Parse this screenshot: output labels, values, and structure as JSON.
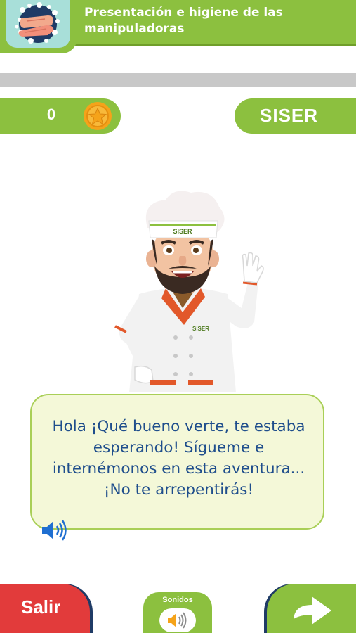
{
  "header": {
    "title": "Presentación e higiene de las manipuladoras",
    "icon": "handwashing-icon"
  },
  "progress": {
    "value": 0
  },
  "score": {
    "value": "0",
    "icon": "star-coin-icon"
  },
  "brand": {
    "name": "SISER"
  },
  "character": {
    "icon": "chef-character"
  },
  "dialog": {
    "text": "Hola ¡Qué bueno verte, te estaba esperando! Sígueme e internémonos en esta aventura... ¡No te arrepentirás!",
    "audio_icon": "speaker-icon"
  },
  "controls": {
    "exit_label": "Salir",
    "sounds_label": "Sonidos",
    "sounds_icon": "speaker-icon",
    "next_icon": "arrow-right-icon"
  },
  "colors": {
    "green": "#8cc03f",
    "red": "#e23b3b",
    "text_blue": "#1f4e8c",
    "bubble_bg": "#f4f8d8",
    "orange": "#f5a31a"
  }
}
